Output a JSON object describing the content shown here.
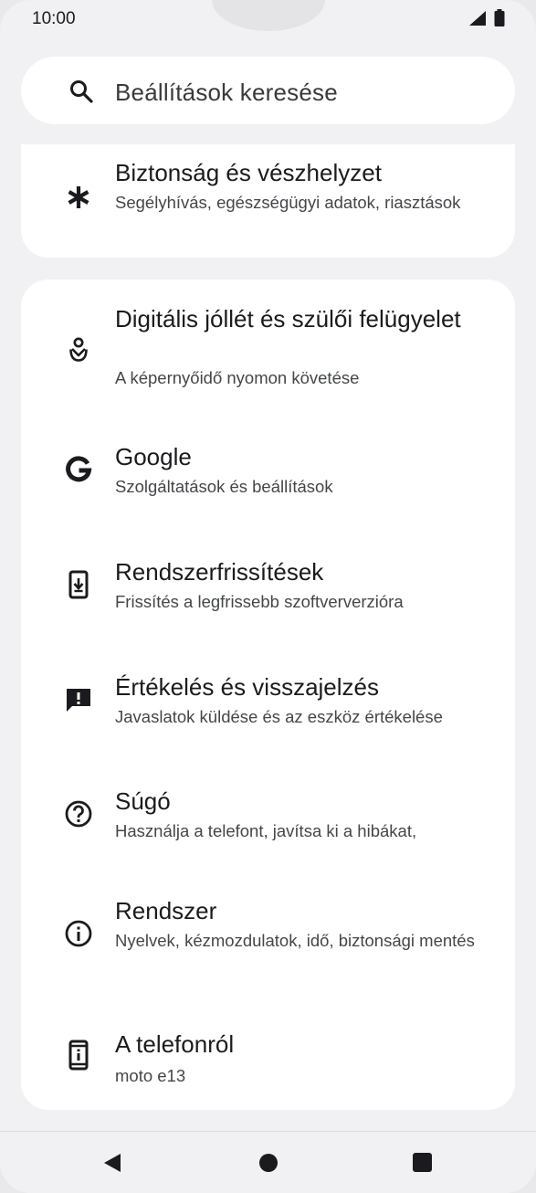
{
  "status_bar": {
    "time": "10:00"
  },
  "search": {
    "placeholder": "Beállítások keresése"
  },
  "items": [
    {
      "icon": "asterisk-icon",
      "title": "Biztonság és vészhelyzet",
      "subtitle": "Segélyhívás, egészségügyi adatok, riasztások"
    },
    {
      "icon": "digital-wellbeing-icon",
      "title": "Digitális jóllét és szülői felügyelet",
      "subtitle": "A képernyőidő nyomon követése"
    },
    {
      "icon": "google-icon",
      "title": "Google",
      "subtitle": "Szolgáltatások és beállítások"
    },
    {
      "icon": "system-update-icon",
      "title": "Rendszerfrissítések",
      "subtitle": "Frissítés a legfrissebb szoftververzióra"
    },
    {
      "icon": "feedback-icon",
      "title": "Értékelés és visszajelzés",
      "subtitle": "Javaslatok küldése és az eszköz értékelése"
    },
    {
      "icon": "help-icon",
      "title": "Súgó",
      "subtitle": "Használja a telefont, javítsa ki a hibákat,"
    },
    {
      "icon": "info-icon",
      "title": "Rendszer",
      "subtitle": "Nyelvek, kézmozdulatok, idő, biztonsági mentés"
    },
    {
      "icon": "phone-info-icon",
      "title": "A telefonról",
      "subtitle": "moto e13"
    }
  ]
}
